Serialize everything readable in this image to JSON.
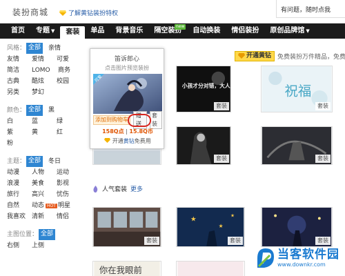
{
  "header": {
    "brand": "装扮商城",
    "diamond_link": "了解黄钻装扮特权",
    "top_right": "有问题，随时点我"
  },
  "nav": {
    "items": [
      "首页",
      "专题",
      "套装",
      "单品",
      "背景音乐",
      "隔空装扮",
      "自动换装",
      "情侣装扮",
      "原创品牌馆"
    ],
    "new_tag": "new"
  },
  "filters": {
    "style": {
      "label": "风格：",
      "options": [
        "全部",
        "亲情",
        "友情",
        "爱情",
        "可爱",
        "简洁",
        "LOMO",
        "商务",
        "古典",
        "酷炫",
        "校园",
        "另类",
        "梦幻"
      ]
    },
    "color": {
      "label": "颜色：",
      "options": [
        "全部",
        "黑",
        "白",
        "蓝",
        "绿",
        "紫",
        "黄",
        "红",
        "粉"
      ]
    },
    "theme": {
      "label": "主题：",
      "options": [
        "全部",
        "冬日",
        "动漫",
        "人物",
        "运动",
        "浪漫",
        "美食",
        "影视",
        "旅行",
        "高兴",
        "忧伤",
        "自然",
        "动态",
        "明星",
        "我喜欢",
        "清新",
        "情侣"
      ],
      "hot": "HOT"
    },
    "position": {
      "label": "主图位置：",
      "options": [
        "全部",
        "右侧",
        "上侧"
      ]
    }
  },
  "promo": {
    "button": "开通黄钻",
    "text": "免费装扮万件精品，免费DIY"
  },
  "popup": {
    "title": "笛诉郎心",
    "subtitle": "点击图片预览装扮",
    "badge": "可爱",
    "cart": "添加到购物车",
    "gift": "赠送",
    "suit": "套装",
    "price_points": "158Q点",
    "price_coins": "15.8Q币",
    "open_prefix": "开通",
    "open_link": "黄钻",
    "open_suffix": "免费用"
  },
  "cards": {
    "tag": "套装",
    "row1_text_a": "小孩才分对错，大人只讲利弊。",
    "row1_text_b": "祝福",
    "row4_text": "你在我眼前"
  },
  "section": {
    "title": "人气套装",
    "more": "更多"
  },
  "watermark": {
    "title": "当客软件园",
    "url": "www.downkr.com"
  },
  "colors": {
    "accent": "#2f86d2",
    "nav_bg": "#1b1b1b",
    "gold": "#ffd84a",
    "highlight_ring": "#d7261f"
  }
}
